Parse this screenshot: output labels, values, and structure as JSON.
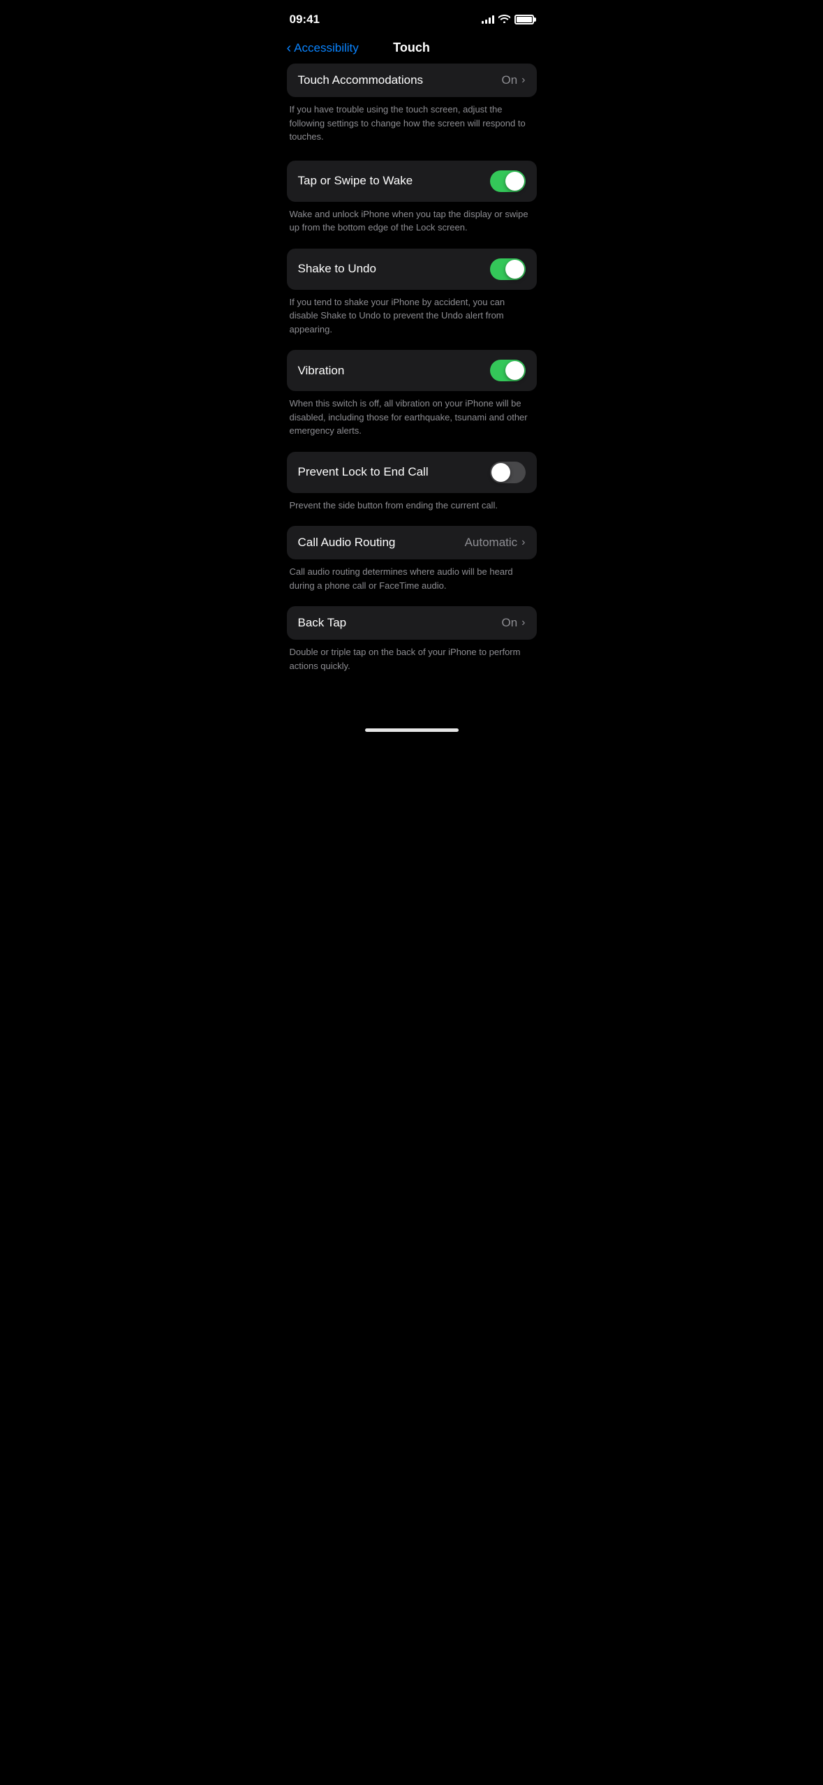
{
  "statusBar": {
    "time": "09:41",
    "batteryFull": true
  },
  "header": {
    "backLabel": "Accessibility",
    "title": "Touch"
  },
  "touchAccommodations": {
    "label": "Touch Accommodations",
    "value": "On",
    "hasChevron": true
  },
  "introDescription": "If you have trouble using the touch screen, adjust the following settings to change how the screen will respond to touches.",
  "settings": [
    {
      "id": "tap-swipe-wake",
      "label": "Tap or Swipe to Wake",
      "toggleOn": true,
      "description": "Wake and unlock iPhone when you tap the display or swipe up from the bottom edge of the Lock screen."
    },
    {
      "id": "shake-to-undo",
      "label": "Shake to Undo",
      "toggleOn": true,
      "description": "If you tend to shake your iPhone by accident, you can disable Shake to Undo to prevent the Undo alert from appearing."
    },
    {
      "id": "vibration",
      "label": "Vibration",
      "toggleOn": true,
      "description": "When this switch is off, all vibration on your iPhone will be disabled, including those for earthquake, tsunami and other emergency alerts."
    },
    {
      "id": "prevent-lock",
      "label": "Prevent Lock to End Call",
      "toggleOn": false,
      "description": "Prevent the side button from ending the current call."
    }
  ],
  "callAudioRouting": {
    "label": "Call Audio Routing",
    "value": "Automatic",
    "hasChevron": true,
    "description": "Call audio routing determines where audio will be heard during a phone call or FaceTime audio."
  },
  "backTap": {
    "label": "Back Tap",
    "value": "On",
    "hasChevron": true,
    "description": "Double or triple tap on the back of your iPhone to perform actions quickly."
  }
}
